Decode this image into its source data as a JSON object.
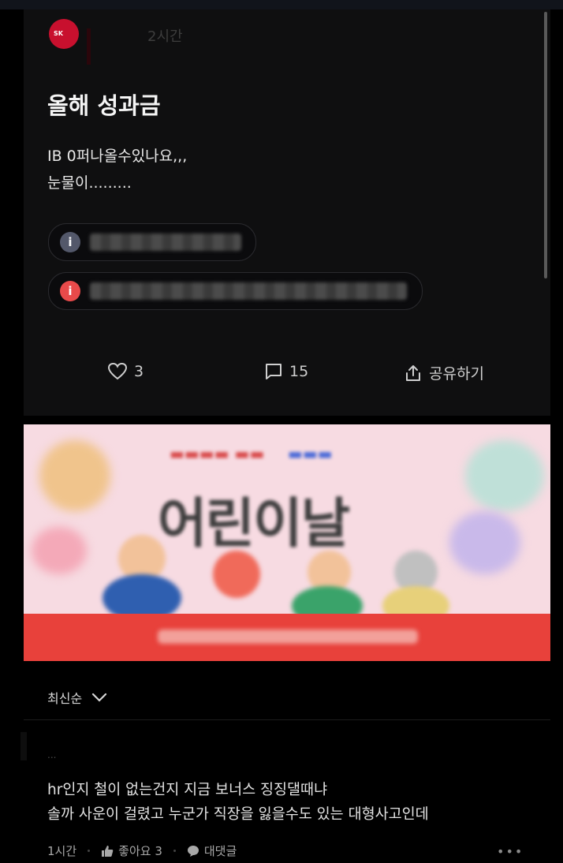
{
  "post": {
    "time": "2시간",
    "title": "올해 성과금",
    "body_line1": "IB 0퍼나올수있나요,,,",
    "body_line2": "눈물이.........",
    "chip_icons": [
      "info-icon",
      "info-icon"
    ],
    "actions": {
      "like_count": "3",
      "comment_count": "15",
      "share_label": "공유하기"
    }
  },
  "ad_banner": {
    "headline": "어린이날"
  },
  "sort": {
    "label": "최신순"
  },
  "comment": {
    "author_placeholder": "...",
    "line1": "hr인지 철이 없는건지 지금 보너스 징징댈때냐",
    "line2": "솔까 사운이 걸렸고 누군가 직장을 잃을수도 있는 대형사고인데",
    "time": "1시간",
    "like_label": "좋아요 3",
    "reply_label": "대댓글",
    "more": "•••"
  },
  "colors": {
    "brand_red": "#c8102e",
    "chip_gray": "#53586a",
    "chip_red": "#e84a4a"
  }
}
